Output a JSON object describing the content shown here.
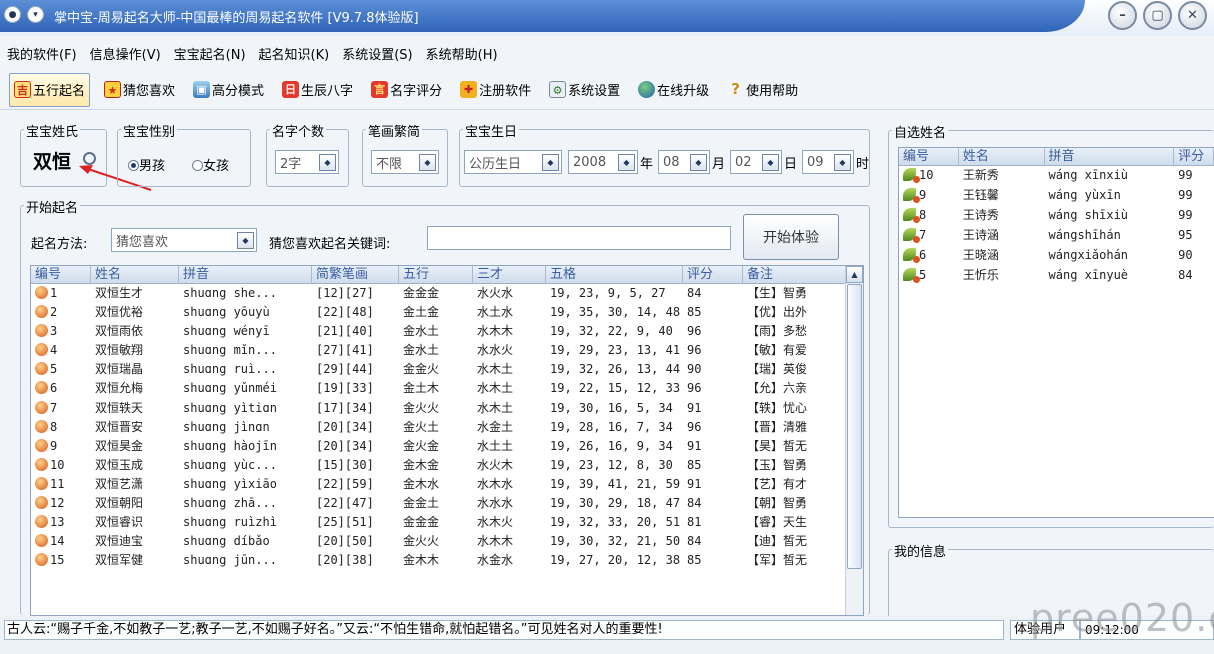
{
  "window": {
    "title": "掌中宝-周易起名大师-中国最棒的周易起名软件 [V9.7.8体验版]",
    "controls": [
      "minimize",
      "maximize",
      "close"
    ]
  },
  "menu": [
    "我的软件(F)",
    "信息操作(V)",
    "宝宝起名(N)",
    "起名知识(K)",
    "系统设置(S)",
    "系统帮助(H)"
  ],
  "toolbar": [
    {
      "label": "五行起名",
      "icon": "wuxing-icon",
      "color": "#e0302a",
      "active": true
    },
    {
      "label": "猜您喜欢",
      "icon": "star-icon",
      "color": "#e0302a",
      "active": false
    },
    {
      "label": "高分模式",
      "icon": "image-icon",
      "color": "#4a88c8",
      "active": false
    },
    {
      "label": "生辰八字",
      "icon": "calendar-icon",
      "color": "#e0302a",
      "active": false
    },
    {
      "label": "名字评分",
      "icon": "score-icon",
      "color": "#e0302a",
      "active": false
    },
    {
      "label": "注册软件",
      "icon": "gift-icon",
      "color": "#d89a10",
      "active": false
    },
    {
      "label": "系统设置",
      "icon": "settings-icon",
      "color": "#3a8a3a",
      "active": false
    },
    {
      "label": "在线升级",
      "icon": "globe-icon",
      "color": "#2060c0",
      "active": false
    },
    {
      "label": "使用帮助",
      "icon": "help-icon",
      "color": "#c89010",
      "active": false
    }
  ],
  "surname": {
    "title": "宝宝姓氏",
    "value": "双恒"
  },
  "gender": {
    "title": "宝宝性别",
    "male": "男孩",
    "female": "女孩",
    "selected": "male"
  },
  "namelen": {
    "title": "名字个数",
    "value": "2字"
  },
  "strokes": {
    "title": "笔画繁简",
    "value": "不限"
  },
  "birthday": {
    "title": "宝宝生日",
    "calendar": "公历生日",
    "year": "2008",
    "year_unit": "年",
    "month": "08",
    "month_unit": "月",
    "day": "02",
    "day_unit": "日",
    "hour": "09",
    "hour_unit": "时"
  },
  "start": {
    "title": "开始起名",
    "method_label": "起名方法:",
    "method_value": "猜您喜欢",
    "keyword_label": "猜您喜欢起名关键词:",
    "keyword_value": "",
    "button": "开始体验"
  },
  "names_table": {
    "headers": [
      "编号",
      "姓名",
      "拼音",
      "简繁笔画",
      "五行",
      "三才",
      "五格",
      "评分",
      "备注"
    ],
    "rows": [
      [
        "1",
        "双恒生才",
        "shuɑng she...",
        "[12][27]",
        "金金金",
        "水火水",
        "19, 23, 9, 5, 27",
        "84",
        "【生】智勇"
      ],
      [
        "2",
        "双恒优裕",
        "shuɑng yōuyù",
        "[22][48]",
        "金土金",
        "水土水",
        "19, 35, 30, 14, 48",
        "85",
        "【优】出外"
      ],
      [
        "3",
        "双恒雨依",
        "shuɑng wényī",
        "[21][40]",
        "金水土",
        "水木木",
        "19, 32, 22, 9, 40",
        "96",
        "【雨】多愁"
      ],
      [
        "4",
        "双恒敏翔",
        "shuɑng mǐn...",
        "[27][41]",
        "金水土",
        "水水火",
        "19, 29, 23, 13, 41",
        "96",
        "【敏】有爱"
      ],
      [
        "5",
        "双恒瑞晶",
        "shuɑng ruì...",
        "[29][44]",
        "金金火",
        "水木土",
        "19, 32, 26, 13, 44",
        "90",
        "【瑞】英俊"
      ],
      [
        "6",
        "双恒允梅",
        "shuɑng yǔnméi",
        "[19][33]",
        "金土木",
        "水木土",
        "19, 22, 15, 12, 33",
        "96",
        "【允】六亲"
      ],
      [
        "7",
        "双恒轶天",
        "shuɑng yìtiɑn",
        "[17][34]",
        "金火火",
        "水木土",
        "19, 30, 16, 5, 34",
        "91",
        "【轶】忧心"
      ],
      [
        "8",
        "双恒晋安",
        "shuɑng jìnɑn",
        "[20][34]",
        "金火土",
        "水金土",
        "19, 28, 16, 7, 34",
        "96",
        "【晋】清雅"
      ],
      [
        "9",
        "双恒昊金",
        "shuɑng hàojīn",
        "[20][34]",
        "金火金",
        "水土土",
        "19, 26, 16, 9, 34",
        "91",
        "【昊】皙无"
      ],
      [
        "10",
        "双恒玉成",
        "shuɑng yùc...",
        "[15][30]",
        "金木金",
        "水火木",
        "19, 23, 12, 8, 30",
        "85",
        "【玉】智勇"
      ],
      [
        "11",
        "双恒艺潇",
        "shuɑng yìxiāo",
        "[22][59]",
        "金木水",
        "水木水",
        "19, 39, 41, 21, 59",
        "91",
        "【艺】有才"
      ],
      [
        "12",
        "双恒朝阳",
        "shuɑng zhā...",
        "[22][47]",
        "金金土",
        "水水水",
        "19, 30, 29, 18, 47",
        "84",
        "【朝】智勇"
      ],
      [
        "13",
        "双恒睿识",
        "shuɑng ruìzhì",
        "[25][51]",
        "金金金",
        "水木火",
        "19, 32, 33, 20, 51",
        "81",
        "【睿】天生"
      ],
      [
        "14",
        "双恒迪宝",
        "shuɑng díbǎo",
        "[20][50]",
        "金火火",
        "水木木",
        "19, 30, 32, 21, 50",
        "84",
        "【迪】皙无"
      ],
      [
        "15",
        "双恒军健",
        "shuɑng jūn...",
        "[20][38]",
        "金木木",
        "水金水",
        "19, 27, 20, 12, 38",
        "85",
        "【军】皙无"
      ]
    ]
  },
  "favorites": {
    "title": "自选姓名",
    "headers": [
      "编号",
      "姓名",
      "拼音",
      "评分"
    ],
    "rows": [
      [
        "10",
        "王新秀",
        "wáng xīnxiù",
        "99"
      ],
      [
        "9",
        "王钰馨",
        "wáng yùxīn",
        "99"
      ],
      [
        "8",
        "王诗秀",
        "wáng shīxiù",
        "99"
      ],
      [
        "7",
        "王诗涵",
        "wángshīhán",
        "95"
      ],
      [
        "6",
        "王晓涵",
        "wángxiǎohán",
        "90"
      ],
      [
        "5",
        "王忻乐",
        "wáng xīnyuè",
        "84"
      ]
    ]
  },
  "myinfo": {
    "title": "我的信息"
  },
  "status": {
    "message": "古人云:“赐子千金,不如教子一艺;教子一艺,不如赐子好名。”又云:“不怕生错命,就怕起错名。”可见姓名对人的重要性!",
    "user": "体验用户",
    "time": "09:12:00"
  },
  "watermark": "pree020.cn"
}
